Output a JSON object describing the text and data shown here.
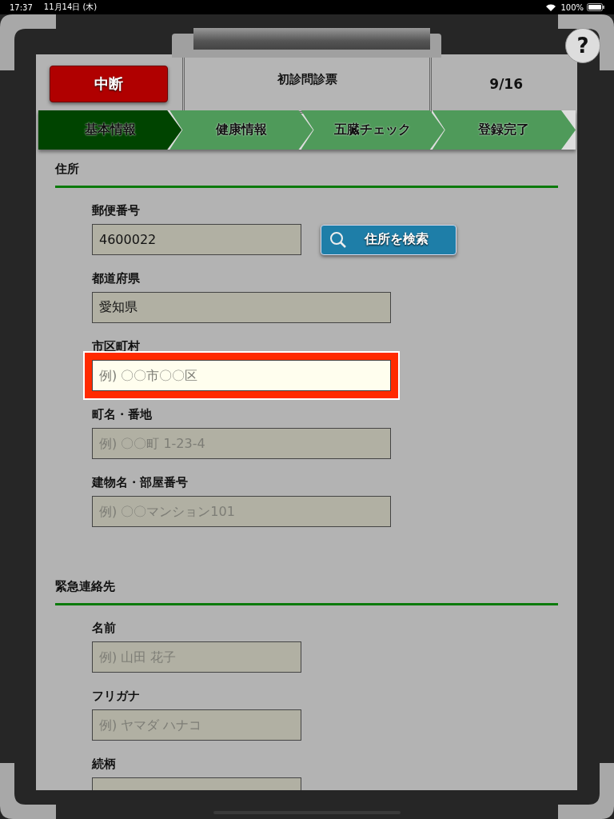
{
  "status_bar": {
    "time": "17:37",
    "date": "11月14日 (木)",
    "battery": "100%"
  },
  "help_button": {
    "label": "?"
  },
  "header": {
    "quit_button": "中断",
    "title": "初診問診票",
    "page": "9/16"
  },
  "steps": [
    {
      "label": "基本情報",
      "selected": true
    },
    {
      "label": "健康情報",
      "selected": false
    },
    {
      "label": "五臓チェック",
      "selected": false
    },
    {
      "label": "登録完了",
      "selected": false
    }
  ],
  "sections": [
    {
      "heading": "住所",
      "fields": [
        {
          "label": "郵便番号",
          "kind": "short",
          "value": "4600022",
          "highlighted": false,
          "button": "住所を検索"
        },
        {
          "label": "都道府県",
          "kind": "long",
          "value": "愛知県",
          "highlighted": false
        },
        {
          "label": "市区町村",
          "kind": "long",
          "placeholder": "例) 〇〇市〇〇区",
          "highlighted": true
        },
        {
          "label": "町名・番地",
          "kind": "long",
          "placeholder": "例) 〇〇町 1-23-4",
          "highlighted": false
        },
        {
          "label": "建物名・部屋番号",
          "kind": "long",
          "placeholder": "例) 〇〇マンション101",
          "highlighted": false
        }
      ]
    },
    {
      "heading": "緊急連絡先",
      "fields": [
        {
          "label": "名前",
          "kind": "short",
          "placeholder": "例) 山田 花子",
          "highlighted": false
        },
        {
          "label": "フリガナ",
          "kind": "short",
          "placeholder": "例) ヤマダ ハナコ",
          "highlighted": false
        },
        {
          "label": "続柄",
          "kind": "short",
          "highlighted": false
        }
      ]
    }
  ]
}
